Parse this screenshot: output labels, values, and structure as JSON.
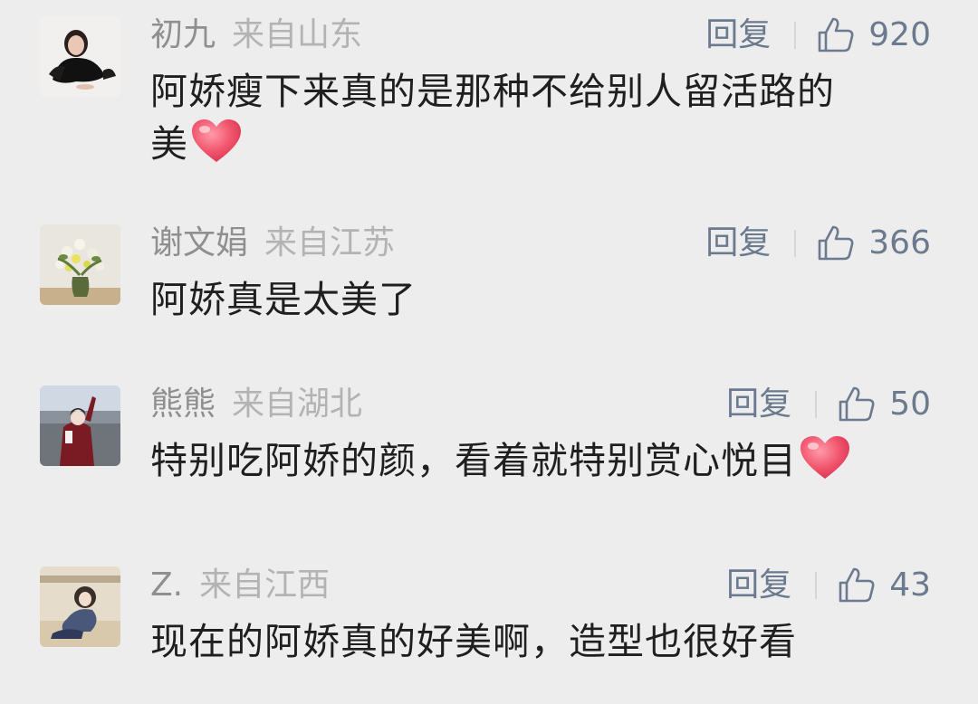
{
  "comments": [
    {
      "name": "初九",
      "location": "来自山东",
      "reply_label": "回复",
      "likes": "920",
      "text": "阿娇瘦下来真的是那种不给别人留活路的美",
      "text_line1": "阿娇瘦下来真的是那种不给别人留活路的",
      "text_line2": "美",
      "emoji": "heart-emoji",
      "avatar": "avatar-woman-black-dress"
    },
    {
      "name": "谢文娟",
      "location": "来自江苏",
      "reply_label": "回复",
      "likes": "366",
      "text": "阿娇真是太美了",
      "emoji": "",
      "avatar": "avatar-flower-vase"
    },
    {
      "name": "熊熊",
      "location": "来自湖北",
      "reply_label": "回复",
      "likes": "50",
      "text": "特别吃阿娇的颜，看着就特别赏心悦目",
      "emoji": "heart-emoji",
      "avatar": "avatar-girl-red-coat"
    },
    {
      "name": "Z.",
      "location": "来自江西",
      "reply_label": "回复",
      "likes": "43",
      "text": "现在的阿娇真的好美啊，造型也很好看",
      "emoji": "",
      "avatar": "avatar-cartoon-figure"
    }
  ],
  "colors": {
    "background": "#ededed",
    "name": "#8f8f8f",
    "location": "#b3b3b3",
    "action": "#6b7a8f",
    "text": "#1f1f1f",
    "heart": "#f0536b"
  }
}
